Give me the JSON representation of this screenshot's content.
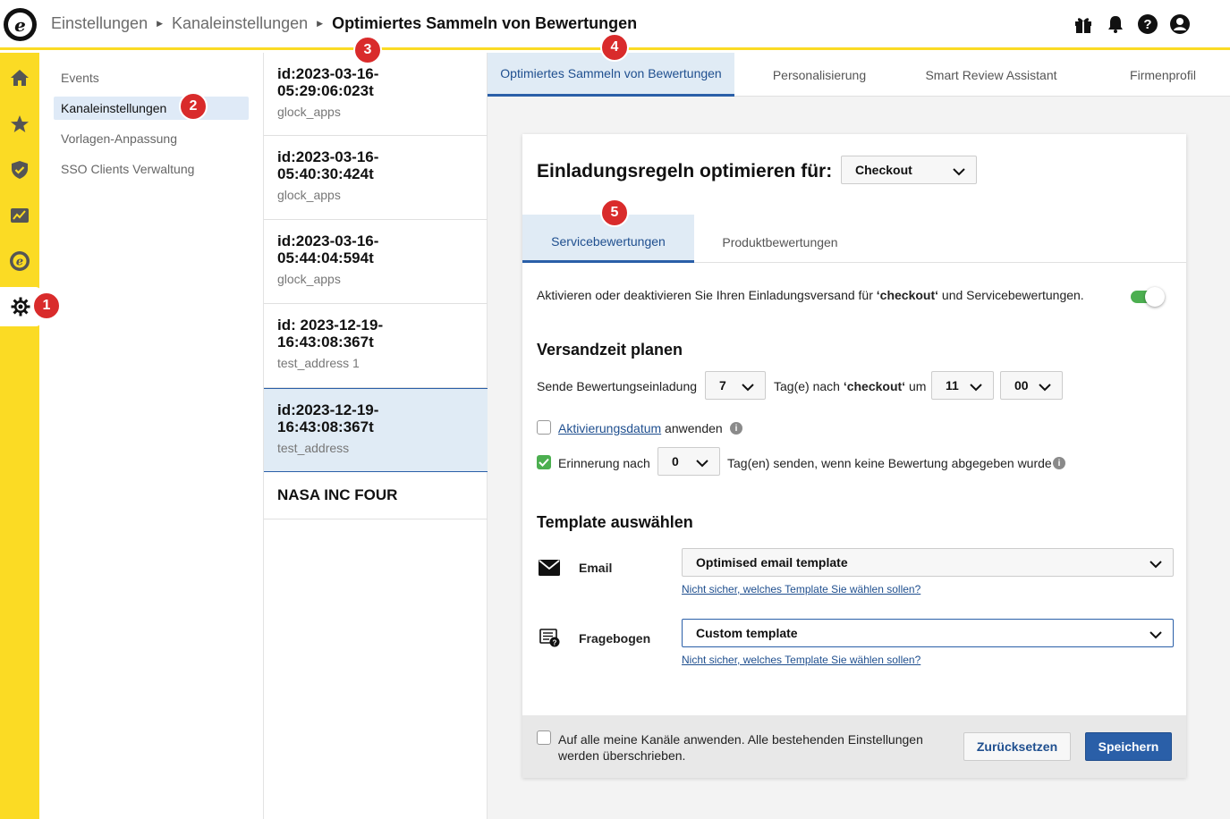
{
  "app": {
    "logo_letter": "e"
  },
  "breadcrumb": {
    "items": [
      "Einstellungen",
      "Kanaleinstellungen"
    ],
    "current": "Optimiertes Sammeln von Bewertungen"
  },
  "top_icons": [
    "gift-icon",
    "bell-icon",
    "help-icon",
    "user-icon"
  ],
  "rail": {
    "items": [
      "home-icon",
      "star-icon",
      "shield-icon",
      "chart-icon",
      "trusted-icon",
      "gear-icon"
    ],
    "active": "gear-icon",
    "accent": "#fbdb24"
  },
  "nav": {
    "items": [
      {
        "label": "Events"
      },
      {
        "label": "Kanaleinstellungen"
      },
      {
        "label": "Vorlagen-Anpassung"
      },
      {
        "label": "SSO Clients Verwaltung"
      }
    ],
    "active_index": 1
  },
  "channels": [
    {
      "title": "id:2023-03-16-05:29:06:023t",
      "title_line1": "id:2023-03-16-",
      "title_line2": "05:29:06:023t",
      "sub": "glock_apps"
    },
    {
      "title": "id:2023-03-16-05:40:30:424t",
      "title_line1": "id:2023-03-16-",
      "title_line2": "05:40:30:424t",
      "sub": "glock_apps"
    },
    {
      "title": "id:2023-03-16-05:44:04:594t",
      "title_line1": "id:2023-03-16-",
      "title_line2": "05:44:04:594t",
      "sub": "glock_apps"
    },
    {
      "title": "id: 2023-12-19-16:43:08:367t",
      "title_line1": "id: 2023-12-19-",
      "title_line2": "16:43:08:367t",
      "sub": "test_address 1"
    },
    {
      "title": "id:2023-12-19-16:43:08:367t",
      "title_line1": "id:2023-12-19-",
      "title_line2": "16:43:08:367t",
      "sub": "test_address"
    },
    {
      "title": "NASA INC FOUR",
      "title_line1": "NASA INC FOUR",
      "title_line2": "",
      "sub": ""
    }
  ],
  "channels_active_index": 4,
  "main_tabs": [
    {
      "label": "Optimiertes Sammeln von Bewertungen"
    },
    {
      "label": "Personalisierung"
    },
    {
      "label": "Smart Review Assistant"
    },
    {
      "label": "Firmenprofil"
    }
  ],
  "card": {
    "title": "Einladungsregeln optimieren für:",
    "trigger_select": "Checkout",
    "inner_tabs": [
      {
        "label": "Servicebewertungen"
      },
      {
        "label": "Produktbewertungen"
      }
    ],
    "activation_text_before": "Aktivieren oder deaktivieren Sie Ihren Einladungsversand für ",
    "activation_text_bold": "‘checkout‘",
    "activation_text_after": " und Servicebewertungen.",
    "toggle_on": true,
    "schedule": {
      "heading": "Versandzeit planen",
      "send_label": "Sende Bewertungseinladung",
      "days_value": "7",
      "after_text_before": "Tag(e) nach ",
      "after_text_bold": "‘checkout‘",
      "after_text_after": " um",
      "hour_value": "11",
      "minute_value": "00",
      "activation_date_link": "Aktivierungsdatum",
      "activation_date_suffix": " anwenden",
      "activation_date_checked": false,
      "reminder_label": "Erinnerung nach",
      "reminder_checked": true,
      "reminder_days_value": "0",
      "reminder_suffix": "Tag(en) senden, wenn keine Bewertung abgegeben wurde"
    },
    "templates": {
      "heading": "Template auswählen",
      "email_label": "Email",
      "email_value": "Optimised email template",
      "email_help": "Nicht sicher, welches Template Sie wählen sollen?",
      "questionnaire_label": "Fragebogen",
      "questionnaire_value": "Custom template",
      "questionnaire_help": "Nicht sicher, welches Template Sie wählen sollen?"
    },
    "footer": {
      "apply_all_line1": "Auf alle meine Kanäle anwenden. Alle bestehenden Einstellungen",
      "apply_all_line2": "werden überschrieben.",
      "apply_all_checked": false,
      "reset_label": "Zurücksetzen",
      "save_label": "Speichern"
    }
  },
  "markers": [
    "1",
    "2",
    "3",
    "4",
    "5"
  ],
  "colors": {
    "accent_yellow": "#fbdb24",
    "primary_blue": "#2a5fa8",
    "active_bg": "#e0ebf5",
    "toggle_green": "#4caf50",
    "marker_red": "#d92b2b"
  }
}
